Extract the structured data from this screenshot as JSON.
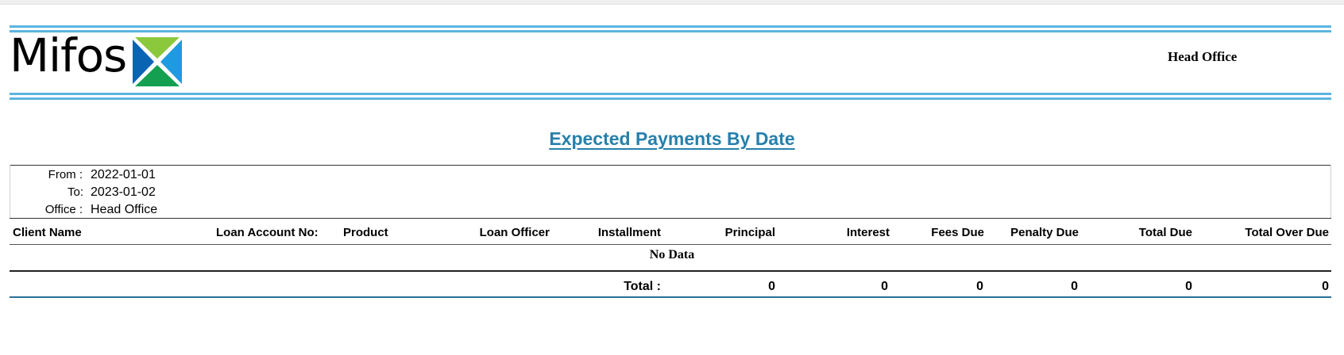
{
  "header": {
    "logo_text": "Mifos",
    "office": "Head Office"
  },
  "title": "Expected Payments By Date",
  "params": [
    {
      "label": "From :",
      "value": "2022-01-01"
    },
    {
      "label": "To:",
      "value": "2023-01-02"
    },
    {
      "label": "Office :",
      "value": "Head Office"
    }
  ],
  "table": {
    "columns": [
      "Client Name",
      "Loan Account No:",
      "Product",
      "Loan Officer",
      "Installment",
      "Principal",
      "Interest",
      "Fees Due",
      "Penalty Due",
      "Total Due",
      "Total Over Due"
    ],
    "empty_text": "No Data",
    "total_label": "Total :",
    "totals": {
      "principal": "0",
      "interest": "0",
      "fees_due": "0",
      "penalty_due": "0",
      "total_due": "0",
      "total_over_due": "0"
    }
  },
  "colors": {
    "accent_line": "#5ab4e0",
    "title": "#2680ab",
    "logo_green_light": "#8cc83c",
    "logo_green_dark": "#14a050",
    "logo_blue_light": "#1e9be0",
    "logo_blue_dark": "#0a64b4"
  }
}
